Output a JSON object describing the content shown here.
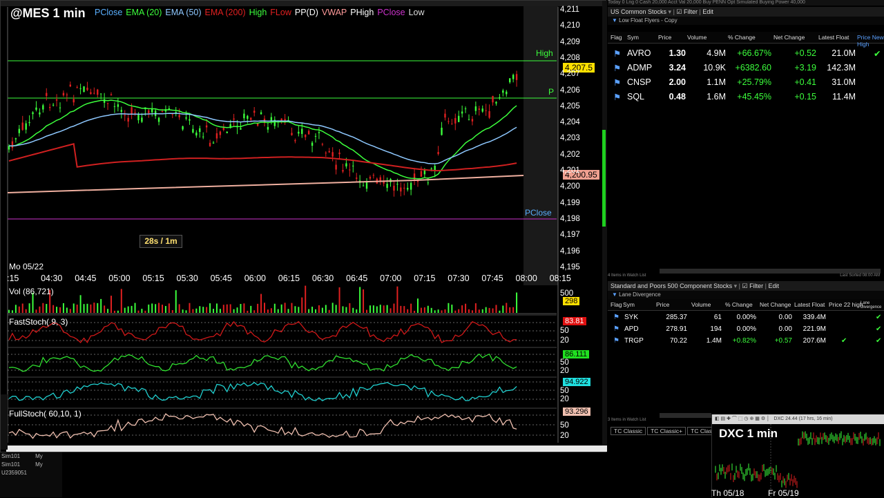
{
  "main_chart": {
    "symbol_title": "@MES 1 min",
    "legend": [
      {
        "label": "PClose",
        "color": "#5ab0ff"
      },
      {
        "label": "EMA (20)",
        "color": "#3cff3c"
      },
      {
        "label": "EMA (50)",
        "color": "#8ec8ff"
      },
      {
        "label": "EMA (200)",
        "color": "#e02020"
      },
      {
        "label": "High",
        "color": "#3cff3c"
      },
      {
        "label": "FLow",
        "color": "#e02020"
      },
      {
        "label": "PP(D)",
        "color": "#ffffff"
      },
      {
        "label": "VWAP",
        "color": "#ff9a9a"
      },
      {
        "label": "PHigh",
        "color": "#ffffff"
      },
      {
        "label": "PClose",
        "color": "#cc33cc"
      },
      {
        "label": "Low",
        "color": "#dddddd"
      }
    ],
    "price_ticks": [
      "4,211",
      "4,210",
      "4,209",
      "4,208",
      "4,207",
      "4,206",
      "4,205",
      "4,204",
      "4,203",
      "4,202",
      "4,201",
      "4,200",
      "4,199",
      "4,198",
      "4,197",
      "4,196",
      "4,195"
    ],
    "last_price_tag": "4,207.5",
    "vwap_tag": "4,200.95",
    "high_label": "High",
    "p_label": "P",
    "pclose_label": "PClose",
    "interval_box": "28s / 1m",
    "date_label": "Mo 05/22",
    "time_ticks": [
      ":15",
      "04:30",
      "04:45",
      "05:00",
      "05:15",
      "05:30",
      "05:45",
      "06:00",
      "06:15",
      "06:30",
      "06:45",
      "07:00",
      "07:15",
      "07:30",
      "07:45",
      "08:00",
      "08:15"
    ]
  },
  "volume_panel": {
    "label": "Vol (86,721)",
    "tick": "500",
    "tag": "298"
  },
  "fast_stoch_panel": {
    "label": "FastStoch( 9, 3)",
    "tag": "83.81",
    "ticks": [
      "50",
      "20"
    ]
  },
  "stoch2_panel": {
    "tag": "86.111",
    "ticks": [
      "50",
      "20"
    ]
  },
  "stoch3_panel": {
    "tag": "94.922",
    "ticks": [
      "50",
      "20"
    ]
  },
  "full_stoch_panel": {
    "label": "FullStoch( 60,10, 1)",
    "tag": "93.296",
    "ticks": [
      "50",
      "20"
    ]
  },
  "accounts": [
    "Sim101",
    "Sim101",
    "U2359051"
  ],
  "account_col": [
    "My",
    "My"
  ],
  "top_strip": "Today 0  Lng 0  Cash 20,000  Acct Val 20,000     Buy  PENN   Opt  Simulated Buying Power 40,000",
  "watchlist_1": {
    "title": "US Common Stocks",
    "filter_label": "Filter",
    "edit_label": "Edit",
    "sublist": "Low Float Flyers - Copy",
    "columns": [
      "Flag",
      "Sym",
      "Price",
      "Volume",
      "% Change",
      "Net Change",
      "Latest Float",
      "Price New High"
    ],
    "rows": [
      {
        "sym": "AVRO",
        "price": "1.30",
        "volume": "4.9M",
        "pct": "+66.67%",
        "net": "+0.52",
        "float": "21.0M",
        "check": "✔"
      },
      {
        "sym": "ADMP",
        "price": "3.24",
        "volume": "10.9K",
        "pct": "+6382.60",
        "net": "+3.19",
        "float": "142.3M",
        "check": ""
      },
      {
        "sym": "CNSP",
        "price": "2.00",
        "volume": "1.1M",
        "pct": "+25.79%",
        "net": "+0.41",
        "float": "31.0M",
        "check": ""
      },
      {
        "sym": "SQL",
        "price": "0.48",
        "volume": "1.6M",
        "pct": "+45.45%",
        "net": "+0.15",
        "float": "11.4M",
        "check": ""
      }
    ],
    "footer": "4 Items in Watch List",
    "footer_right": "Last Sorted 08:00 AM"
  },
  "watchlist_2": {
    "title": "Standard and Poors 500 Component Stocks",
    "filter_label": "Filter",
    "edit_label": "Edit",
    "sublist": "Lane Divergence",
    "columns": [
      "Flag",
      "Sym",
      "Price",
      "Volume",
      "% Change",
      "Net Change",
      "Latest Float",
      "Price 22 high",
      "Lane Divergence"
    ],
    "rows": [
      {
        "sym": "SYK",
        "price": "285.37",
        "volume": "61",
        "pct": "0.00%",
        "net": "0.00",
        "float": "339.4M",
        "c1": "",
        "c2": "✔"
      },
      {
        "sym": "APD",
        "price": "278.91",
        "volume": "194",
        "pct": "0.00%",
        "net": "0.00",
        "float": "221.9M",
        "c1": "",
        "c2": "✔"
      },
      {
        "sym": "TRGP",
        "price": "70.22",
        "volume": "1.4M",
        "pct": "+0.82%",
        "net": "+0.57",
        "float": "207.6M",
        "c1": "✔",
        "c2": "✔"
      }
    ],
    "footer": "3 Items in Watch List"
  },
  "tabs": [
    "TC Classic",
    "TC Classic+",
    "TC Classic"
  ],
  "dxc_chart": {
    "title": "DXC 1 min",
    "toolbar_text": "DXC 24.44 (17 hrs, 16 min)",
    "date_ticks": [
      "Th 05/18",
      "Fr 05/19"
    ]
  }
}
